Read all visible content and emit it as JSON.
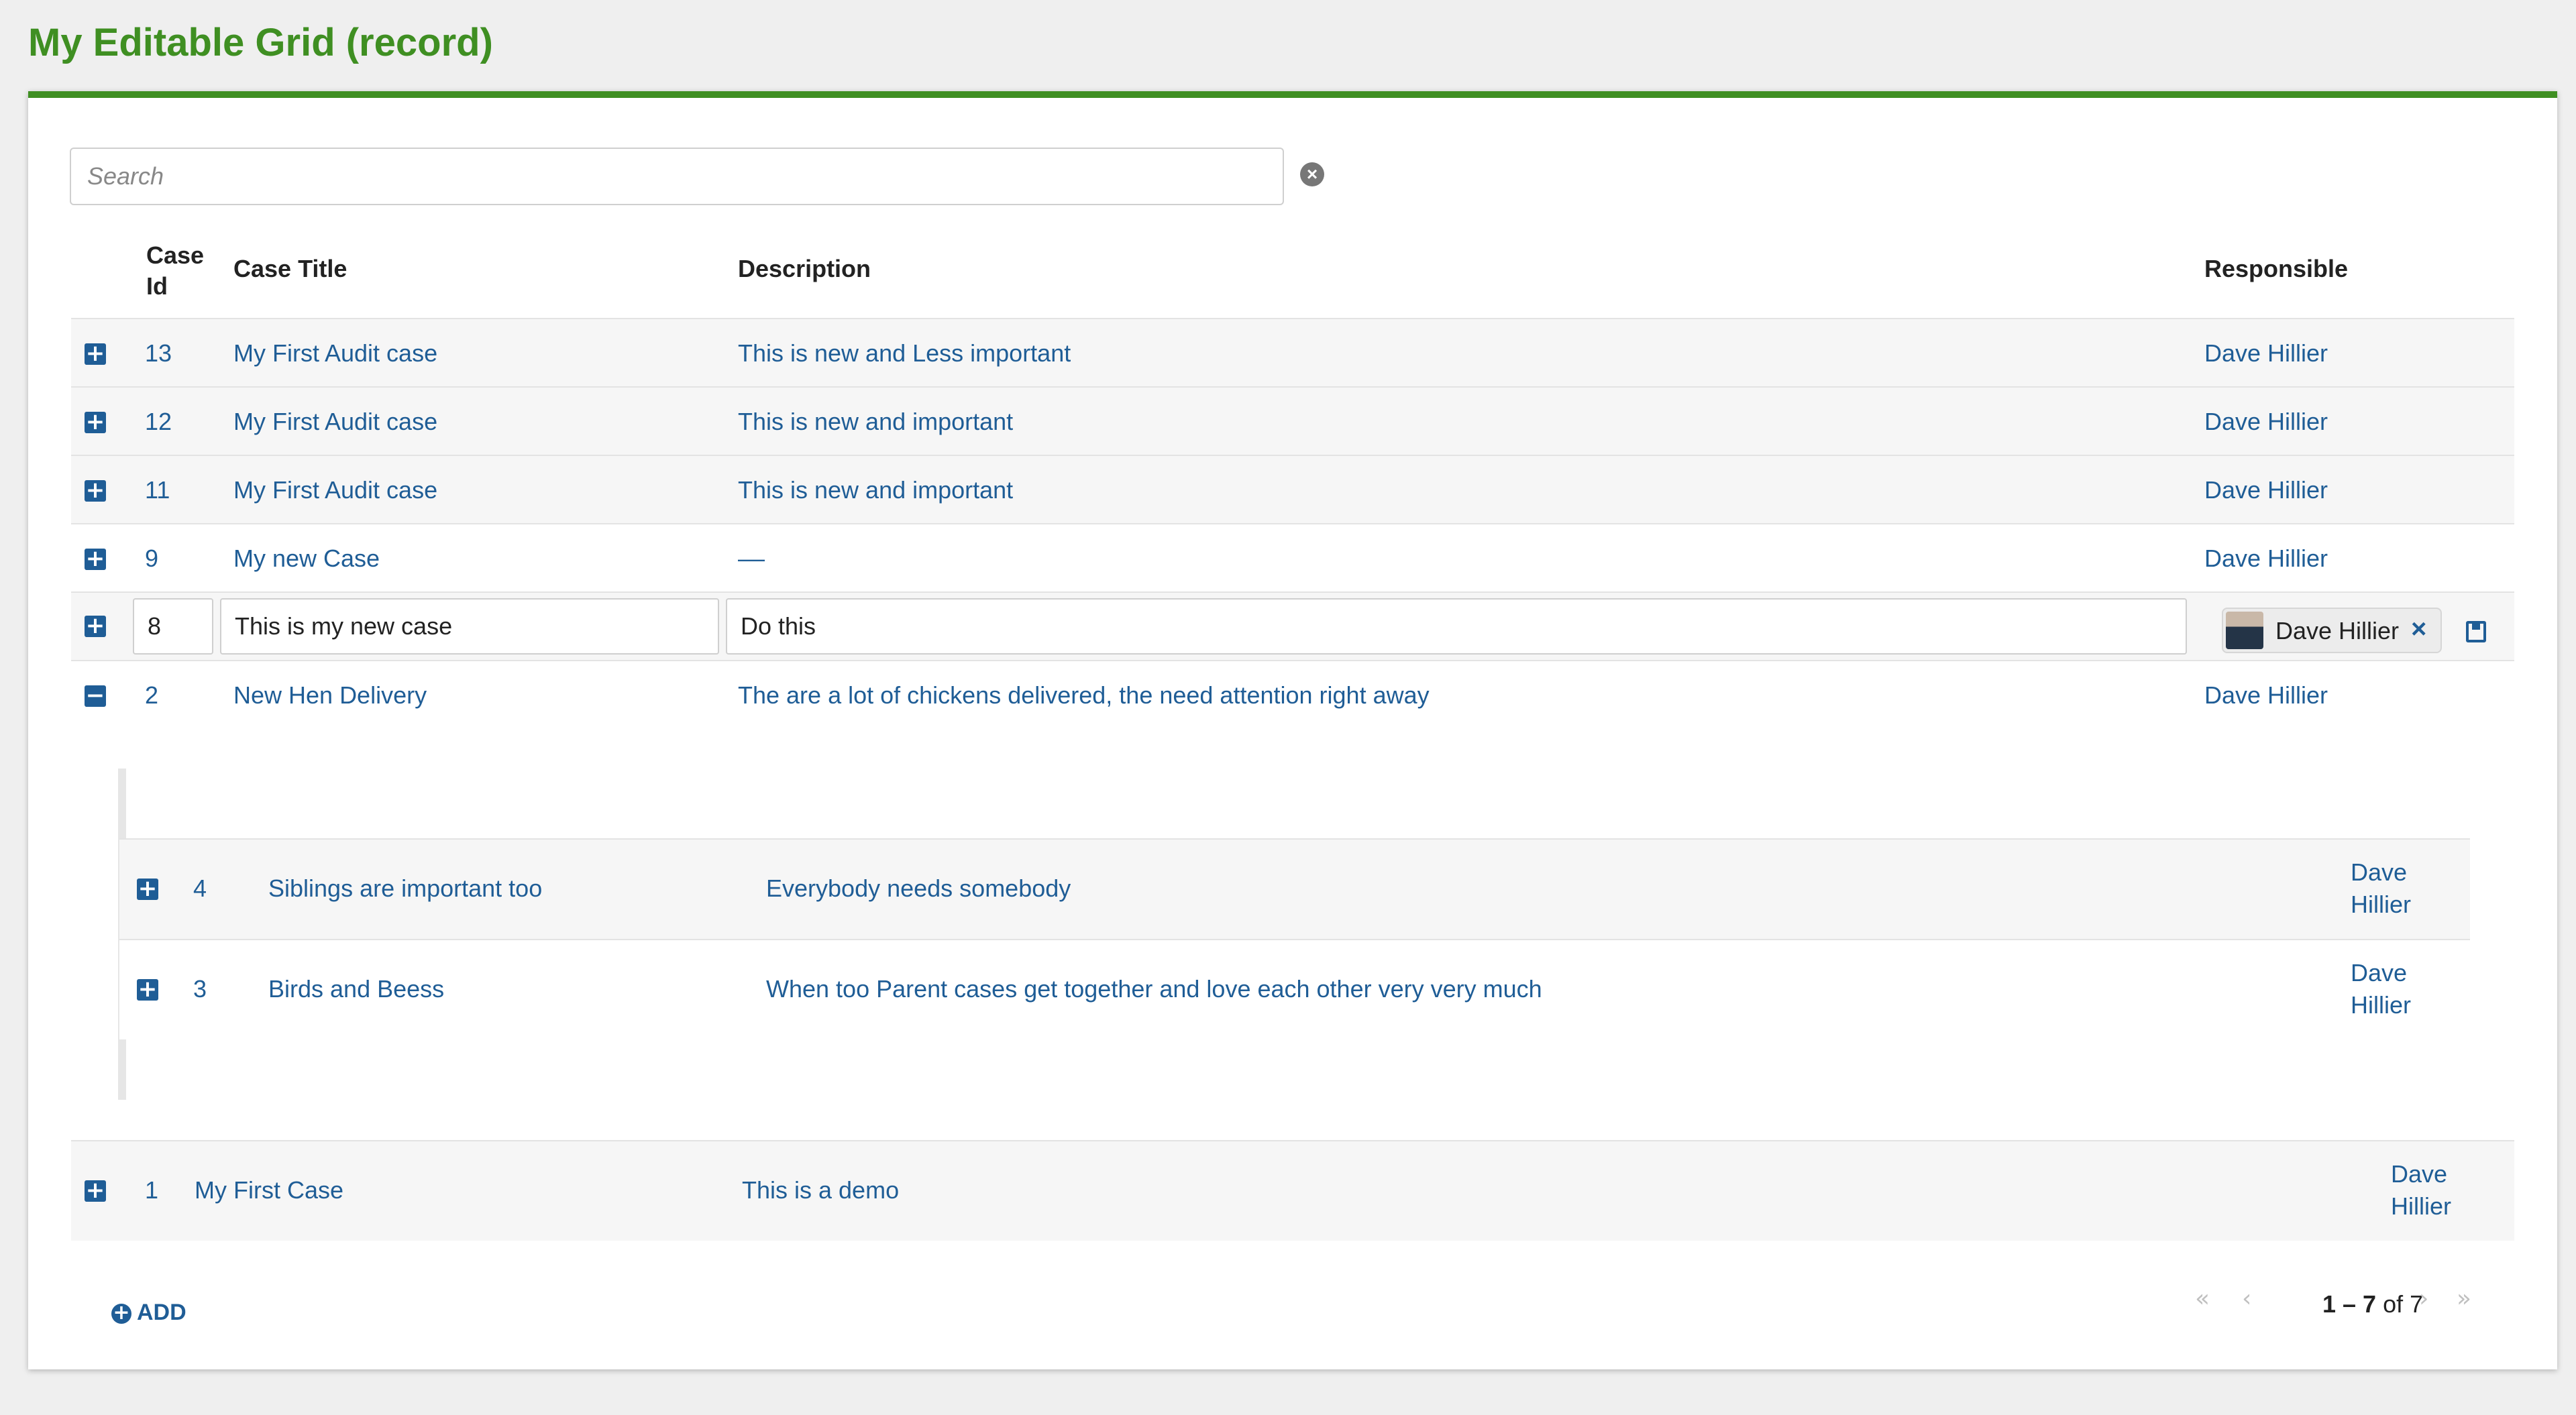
{
  "title": "My Editable Grid (record)",
  "search": {
    "placeholder": "Search"
  },
  "icons": {
    "clear": "close-circle-icon",
    "expand": "plus-square-icon",
    "collapse": "minus-square-icon",
    "save": "save-icon",
    "remove": "x-icon",
    "add": "plus-circle-icon"
  },
  "columns": {
    "id": "Case Id",
    "title": "Case Title",
    "description": "Description",
    "responsible": "Responsible"
  },
  "rows": [
    {
      "id": "13",
      "title": "My First Audit case",
      "description": "This is new and Less important",
      "responsible": "Dave Hillier"
    },
    {
      "id": "12",
      "title": "My First Audit case",
      "description": "This is new and important",
      "responsible": "Dave Hillier"
    },
    {
      "id": "11",
      "title": "My First Audit case",
      "description": "This is new and important",
      "responsible": "Dave Hillier"
    },
    {
      "id": "9",
      "title": "My new Case",
      "description": "––",
      "responsible": "Dave Hillier"
    }
  ],
  "editing_row": {
    "id": "8",
    "title": "This is my new case",
    "description": "Do this",
    "responsible": "Dave Hillier"
  },
  "expanded_row": {
    "id": "2",
    "title": "New Hen Delivery",
    "description": "The are a lot of chickens delivered, the need attention right away",
    "responsible": "Dave Hillier"
  },
  "child_rows": [
    {
      "id": "4",
      "title": "Siblings are important too",
      "description": "Everybody needs somebody",
      "responsible_first": "Dave",
      "responsible_last": "Hillier"
    },
    {
      "id": "3",
      "title": "Birds and Beess",
      "description": "When too Parent cases get together and love each other very very much",
      "responsible_first": "Dave",
      "responsible_last": "Hillier"
    }
  ],
  "last_row": {
    "id": "1",
    "title": "My First Case",
    "description": "This is a demo",
    "responsible_first": "Dave",
    "responsible_last": "Hillier"
  },
  "footer": {
    "add_label": "ADD",
    "range": "1 – 7",
    "of_label": "of",
    "total": "7"
  }
}
